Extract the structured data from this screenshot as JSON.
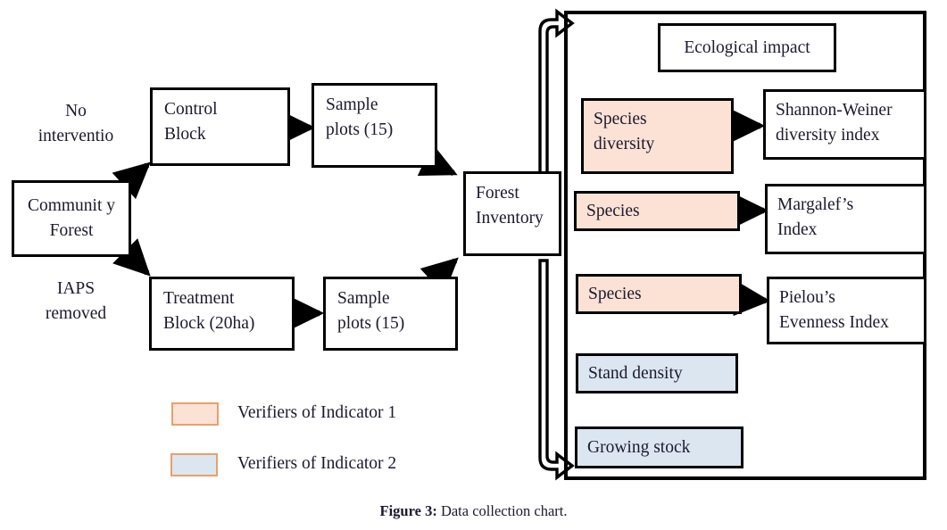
{
  "figure": {
    "caption_label": "Figure 3:",
    "caption_text": " Data collection chart."
  },
  "flow": {
    "source_box": "Communit y Forest",
    "branch_labels": {
      "top": "No\ninterventio",
      "bottom": "IAPS\nremoved"
    },
    "control_block": "Control\nBlock",
    "treatment_block": "Treatment\nBlock (20ha)",
    "sample_plots_top": "Sample\nplots (15)",
    "sample_plots_bottom": "Sample\nplots (15)",
    "forest_inventory": "Forest\nInventory"
  },
  "panel": {
    "title_box": "Ecological impact",
    "verifiers": [
      {
        "source": "Species\ndiversity",
        "target": "Shannon-Weiner\ndiversity index",
        "fill": "#fbe2d5",
        "indicator": 1
      },
      {
        "source": "Species",
        "target": "Margalef’s\nIndex",
        "fill": "#fbe2d5",
        "indicator": 1
      },
      {
        "source": "Species",
        "target": "Pielou’s\nEvenness Index",
        "fill": "#fbe2d5",
        "indicator": 1
      },
      {
        "source": "Stand density",
        "target": "",
        "fill": "#dce6f1",
        "indicator": 2
      },
      {
        "source": "Growing stock",
        "target": "",
        "fill": "#dce6f1",
        "indicator": 2
      }
    ]
  },
  "legend": {
    "items": [
      {
        "label": "Verifiers of Indicator 1",
        "fill": "#fbe2d5",
        "border": "#e8a06a"
      },
      {
        "label": "Verifiers of Indicator 2",
        "fill": "#dce6f1",
        "border": "#e8a06a"
      }
    ]
  },
  "colors": {
    "indicator1_fill": "#fbe2d5",
    "indicator2_fill": "#dce6f1",
    "stroke": "#000000",
    "text": "#1a1a2e",
    "legend_border": "#e8a06a"
  }
}
